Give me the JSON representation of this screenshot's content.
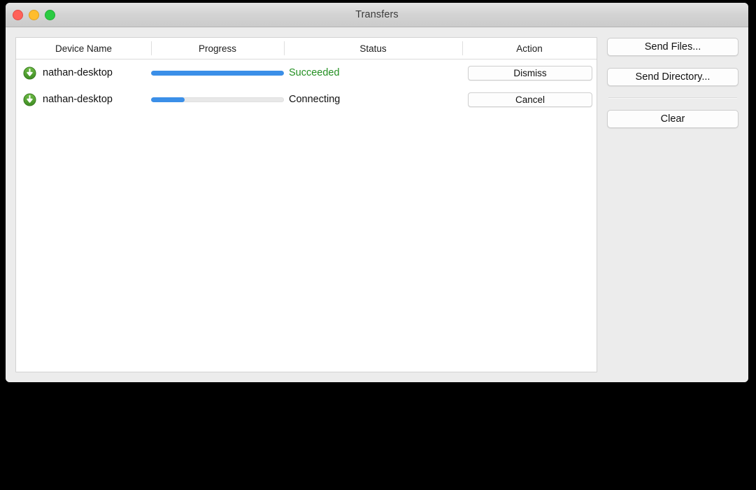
{
  "window": {
    "title": "Transfers",
    "traffic_lights": [
      {
        "name": "close",
        "color": "#ff6159"
      },
      {
        "name": "minimize",
        "color": "#ffbd2e"
      },
      {
        "name": "maximize",
        "color": "#2acb42"
      }
    ]
  },
  "table": {
    "columns": [
      {
        "key": "device",
        "label": "Device Name"
      },
      {
        "key": "progress",
        "label": "Progress"
      },
      {
        "key": "status",
        "label": "Status"
      },
      {
        "key": "action",
        "label": "Action"
      }
    ],
    "rows": [
      {
        "icon": "download-circle-icon",
        "device_name": "nathan-desktop",
        "progress_percent": 100,
        "status": "Succeeded",
        "status_color": "#249023",
        "action_label": "Dismiss"
      },
      {
        "icon": "download-circle-icon",
        "device_name": "nathan-desktop",
        "progress_percent": 25,
        "status": "Connecting",
        "status_color": "#111111",
        "action_label": "Cancel"
      }
    ]
  },
  "sidebar": {
    "buttons": [
      {
        "label": "Send Files..."
      },
      {
        "label": "Send Directory..."
      },
      {
        "label": "Clear"
      }
    ]
  },
  "colors": {
    "accent_progress": "#3b8fe8",
    "success_text": "#249023",
    "icon_green": "#4aa72e",
    "window_bg": "#ececec",
    "table_bg": "#ffffff"
  }
}
